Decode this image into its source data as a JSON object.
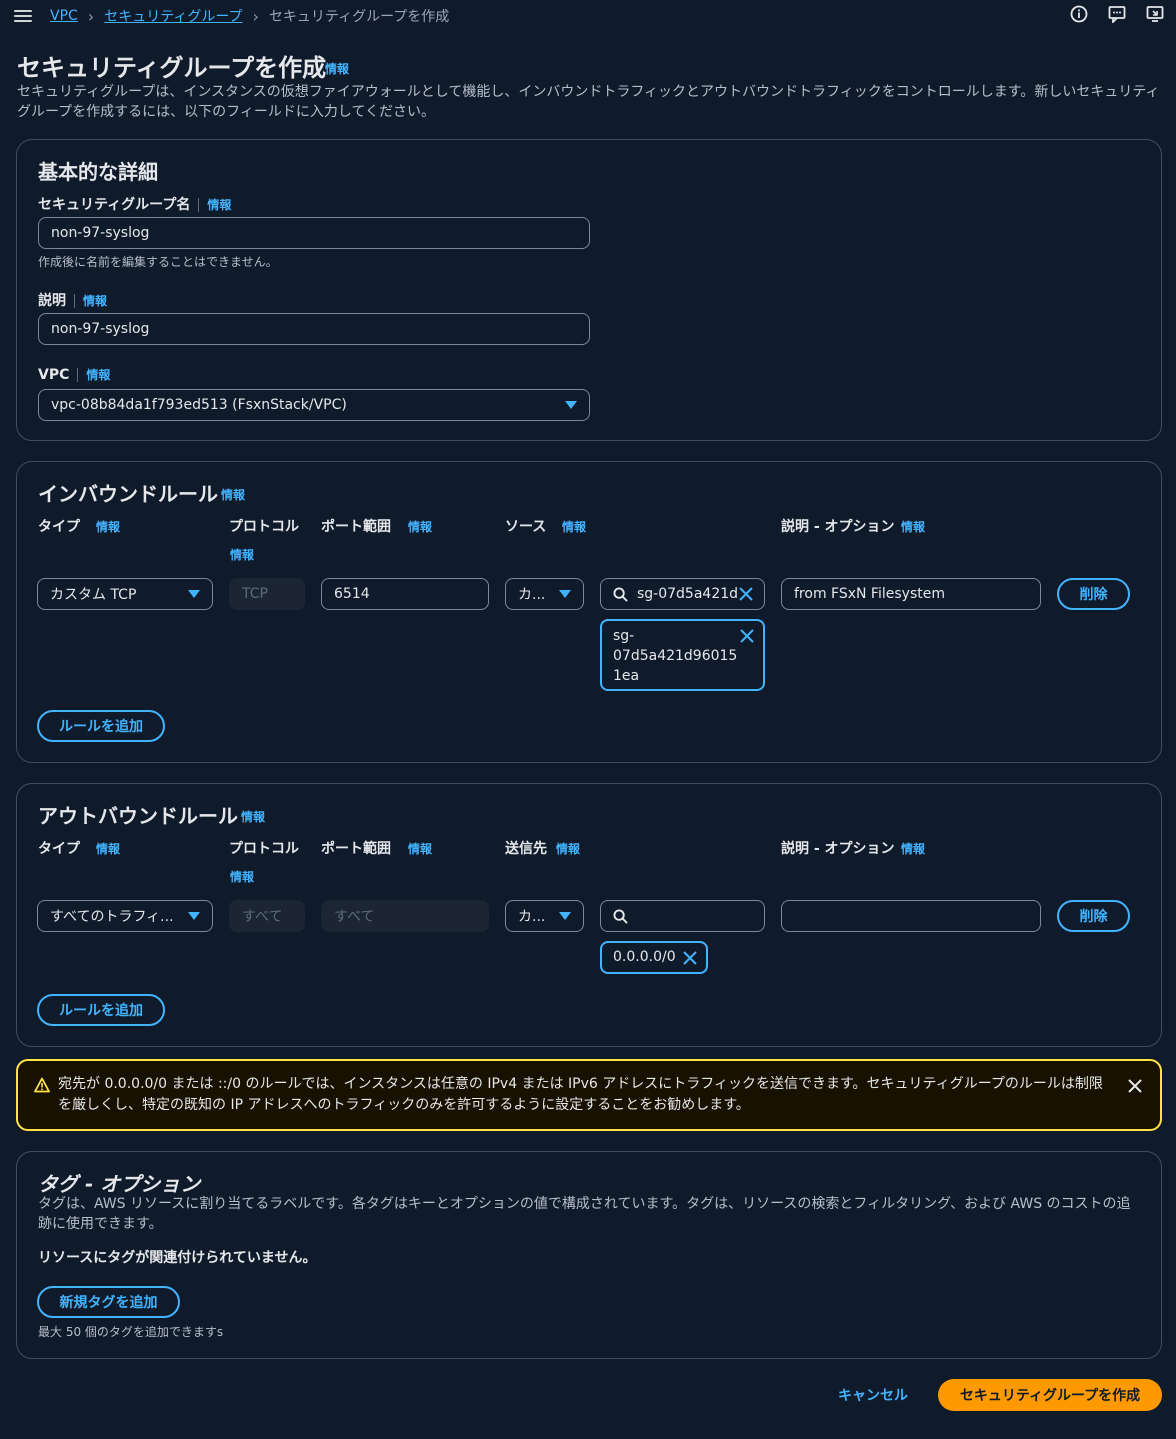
{
  "breadcrumb": {
    "items": [
      "VPC",
      "セキュリティグループ"
    ],
    "current": "セキュリティグループを作成"
  },
  "header": {
    "icons": [
      "info-icon",
      "feedback-icon",
      "fullscreen-icon"
    ]
  },
  "page": {
    "title": "セキュリティグループを作成",
    "info": "情報",
    "description": "セキュリティグループは、インスタンスの仮想ファイアウォールとして機能し、インバウンドトラフィックとアウトバウンドトラフィックをコントロールします。新しいセキュリティグループを作成するには、以下のフィールドに入力してください。"
  },
  "basic": {
    "title": "基本的な詳細",
    "name_label": "セキュリティグループ名",
    "name_info": "情報",
    "name_value": "non-97-syslog",
    "name_hint": "作成後に名前を編集することはできません。",
    "desc_label": "説明",
    "desc_info": "情報",
    "desc_value": "non-97-syslog",
    "vpc_label": "VPC",
    "vpc_info": "情報",
    "vpc_value": "vpc-08b84da1f793ed513 (FsxnStack/VPC)"
  },
  "inbound": {
    "title": "インバウンドルール",
    "info": "情報",
    "col_type": "タイプ",
    "col_protocol": "プロトコル",
    "col_port": "ポート範囲",
    "col_source": "ソース",
    "col_desc": "説明 - オプション",
    "info_label": "情報",
    "type_value": "カスタム TCP",
    "protocol_value": "TCP",
    "port_value": "6514",
    "source_type": "カ...",
    "search_value": "sg-07d5a421d",
    "token_value": "sg-\n07d5a421d96015\n1ea",
    "desc_value": "from FSxN Filesystem",
    "delete": "削除",
    "add_rule": "ルールを追加"
  },
  "outbound": {
    "title": "アウトバウンドルール",
    "info": "情報",
    "col_type": "タイプ",
    "col_protocol": "プロトコル",
    "col_port": "ポート範囲",
    "col_dest": "送信先",
    "col_desc": "説明 - オプション",
    "info_label": "情報",
    "type_value": "すべてのトラフィ...",
    "protocol_value": "すべて",
    "port_value": "すべて",
    "dest_type": "カ...",
    "search_value": "",
    "token_value": "0.0.0.0/0",
    "desc_value": "",
    "delete": "削除",
    "add_rule": "ルールを追加"
  },
  "warning": {
    "text": "宛先が 0.0.0.0/0 または ::/0 のルールでは、インスタンスは任意の IPv4 または IPv6 アドレスにトラフィックを送信できます。セキュリティグループのルールは制限を厳しくし、特定の既知の IP アドレスへのトラフィックのみを許可するように設定することをお勧めします。"
  },
  "tags": {
    "title": "タグ - オプション",
    "description": "タグは、AWS リソースに割り当てるラベルです。各タグはキーとオプションの値で構成されています。タグは、リソースの検索とフィルタリング、および AWS のコストの追跡に使用できます。",
    "empty": "リソースにタグが関連付けられていません。",
    "add_tag": "新規タグを追加",
    "limit": "最大 50 個のタグを追加できますs"
  },
  "footer": {
    "cancel": "キャンセル",
    "create": "セキュリティグループを作成"
  },
  "colors": {
    "background": "#0f1b2a",
    "accent": "#42b4ff",
    "primary": "#ff9900",
    "warning": "#ffe347"
  }
}
